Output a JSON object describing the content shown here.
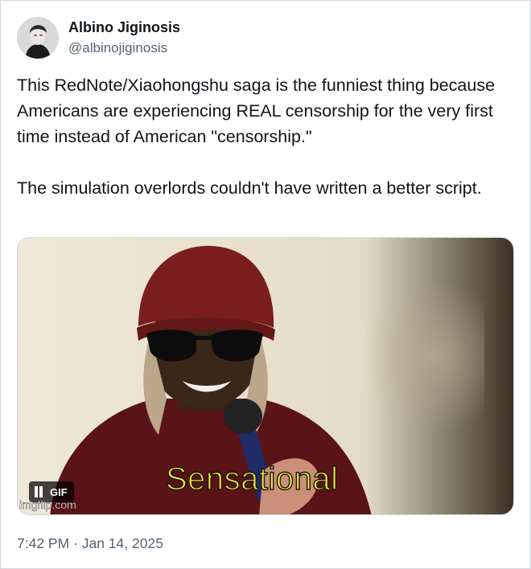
{
  "author": {
    "display_name": "Albino Jiginosis",
    "handle": "@albinojiginosis",
    "avatar_icon": "profile-photo"
  },
  "tweet": {
    "text": "This RedNote/Xiaohongshu saga is the funniest thing because Americans are experiencing REAL censorship for the very first time instead of American \"censorship.\"\n\nThe simulation overlords couldn't have written a better script."
  },
  "media": {
    "type": "gif",
    "caption": "Sensational",
    "badge_label": "GIF",
    "badge_icon": "pause-icon",
    "watermark": "imgflip.com"
  },
  "meta": {
    "timestamp": "7:42 PM · Jan 14, 2025"
  },
  "colors": {
    "text": "#0f1419",
    "secondary_text": "#536471",
    "border": "#cfd9de",
    "caption_yellow": "#f3e84c",
    "hat_maroon": "#7a1e1e"
  }
}
